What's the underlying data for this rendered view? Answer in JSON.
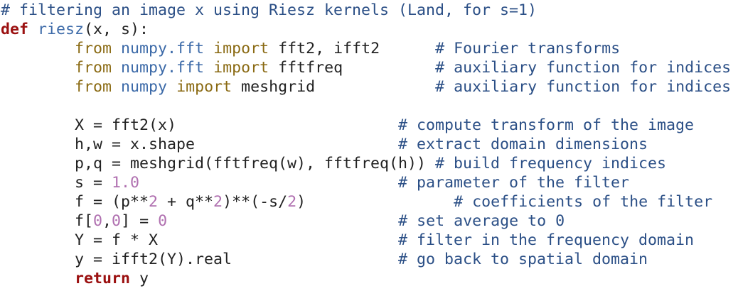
{
  "colors": {
    "comment": "#2b4f86",
    "keyword": "#9b1010",
    "import": "#8a6a13",
    "module": "#3c6aa8",
    "number": "#b070b0",
    "text": "#222222",
    "background": "#ffffff"
  },
  "code_lines": [
    [
      {
        "t": "# filtering an image x using Riesz kernels (Land, for s=1)",
        "k": "comment"
      }
    ],
    [
      {
        "t": "def",
        "k": "keyword"
      },
      {
        "t": " ",
        "k": "plain"
      },
      {
        "t": "riesz",
        "k": "funcname"
      },
      {
        "t": "(x, s):",
        "k": "plain"
      }
    ],
    [
      {
        "t": "        ",
        "k": "plain"
      },
      {
        "t": "from",
        "k": "import"
      },
      {
        "t": " ",
        "k": "plain"
      },
      {
        "t": "numpy.fft",
        "k": "module"
      },
      {
        "t": " ",
        "k": "plain"
      },
      {
        "t": "import",
        "k": "import"
      },
      {
        "t": " fft2, ifft2      ",
        "k": "plain"
      },
      {
        "t": "# Fourier transforms",
        "k": "comment"
      }
    ],
    [
      {
        "t": "        ",
        "k": "plain"
      },
      {
        "t": "from",
        "k": "import"
      },
      {
        "t": " ",
        "k": "plain"
      },
      {
        "t": "numpy.fft",
        "k": "module"
      },
      {
        "t": " ",
        "k": "plain"
      },
      {
        "t": "import",
        "k": "import"
      },
      {
        "t": " fftfreq          ",
        "k": "plain"
      },
      {
        "t": "# auxiliary function for indices",
        "k": "comment"
      }
    ],
    [
      {
        "t": "        ",
        "k": "plain"
      },
      {
        "t": "from",
        "k": "import"
      },
      {
        "t": " ",
        "k": "plain"
      },
      {
        "t": "numpy",
        "k": "module"
      },
      {
        "t": " ",
        "k": "plain"
      },
      {
        "t": "import",
        "k": "import"
      },
      {
        "t": " meshgrid             ",
        "k": "plain"
      },
      {
        "t": "# auxiliary function for indices",
        "k": "comment"
      }
    ],
    [
      {
        "t": "",
        "k": "plain"
      }
    ],
    [
      {
        "t": "        X = fft2(x)                        ",
        "k": "plain"
      },
      {
        "t": "# compute transform of the image",
        "k": "comment"
      }
    ],
    [
      {
        "t": "        h,w = x.shape                      ",
        "k": "plain"
      },
      {
        "t": "# extract domain dimensions",
        "k": "comment"
      }
    ],
    [
      {
        "t": "        p,q = meshgrid(fftfreq(w), fftfreq(h)) ",
        "k": "plain"
      },
      {
        "t": "# build frequency indices",
        "k": "comment"
      }
    ],
    [
      {
        "t": "        s = ",
        "k": "plain"
      },
      {
        "t": "1.0",
        "k": "number"
      },
      {
        "t": "                            ",
        "k": "plain"
      },
      {
        "t": "# parameter of the filter",
        "k": "comment"
      }
    ],
    [
      {
        "t": "        f = (p**",
        "k": "plain"
      },
      {
        "t": "2",
        "k": "number"
      },
      {
        "t": " + q**",
        "k": "plain"
      },
      {
        "t": "2",
        "k": "number"
      },
      {
        "t": ")**(-s/",
        "k": "plain"
      },
      {
        "t": "2",
        "k": "number"
      },
      {
        "t": ")                ",
        "k": "plain"
      },
      {
        "t": "# coefficients of the filter",
        "k": "comment"
      }
    ],
    [
      {
        "t": "        f[",
        "k": "plain"
      },
      {
        "t": "0",
        "k": "number"
      },
      {
        "t": ",",
        "k": "plain"
      },
      {
        "t": "0",
        "k": "number"
      },
      {
        "t": "] = ",
        "k": "plain"
      },
      {
        "t": "0",
        "k": "number"
      },
      {
        "t": "                         ",
        "k": "plain"
      },
      {
        "t": "# set average to 0",
        "k": "comment"
      }
    ],
    [
      {
        "t": "        Y = f * X                          ",
        "k": "plain"
      },
      {
        "t": "# filter in the frequency domain",
        "k": "comment"
      }
    ],
    [
      {
        "t": "        y = ifft2(Y).real                  ",
        "k": "plain"
      },
      {
        "t": "# go back to spatial domain",
        "k": "comment"
      }
    ],
    [
      {
        "t": "        ",
        "k": "plain"
      },
      {
        "t": "return",
        "k": "keyword"
      },
      {
        "t": " y",
        "k": "plain"
      }
    ]
  ]
}
